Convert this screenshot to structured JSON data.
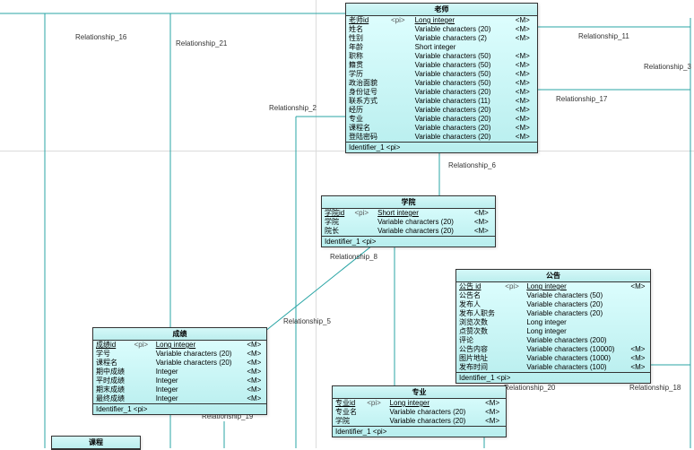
{
  "chart_data": {
    "type": "table",
    "description": "ER conceptual data model (PowerDesigner style)",
    "entities": [
      {
        "name": "老师",
        "identifier": "Identifier_1 <pi>",
        "attributes": [
          [
            "老师id",
            "<pi>",
            "Long integer",
            "<M>"
          ],
          [
            "姓名",
            "",
            "Variable characters (20)",
            "<M>"
          ],
          [
            "性别",
            "",
            "Variable characters (2)",
            "<M>"
          ],
          [
            "年龄",
            "",
            "Short integer",
            ""
          ],
          [
            "职称",
            "",
            "Variable characters (50)",
            "<M>"
          ],
          [
            "籍贯",
            "",
            "Variable characters (50)",
            "<M>"
          ],
          [
            "学历",
            "",
            "Variable characters (50)",
            "<M>"
          ],
          [
            "政治面貌",
            "",
            "Variable characters (50)",
            "<M>"
          ],
          [
            "身份证号",
            "",
            "Variable characters (20)",
            "<M>"
          ],
          [
            "联系方式",
            "",
            "Variable characters (11)",
            "<M>"
          ],
          [
            "经历",
            "",
            "Variable characters (20)",
            "<M>"
          ],
          [
            "专业",
            "",
            "Variable characters (20)",
            "<M>"
          ],
          [
            "课程名",
            "",
            "Variable characters (20)",
            "<M>"
          ],
          [
            "登陆密码",
            "",
            "Variable characters (20)",
            "<M>"
          ]
        ]
      },
      {
        "name": "学院",
        "identifier": "Identifier_1 <pi>",
        "attributes": [
          [
            "学院id",
            "<pi>",
            "Short integer",
            "<M>"
          ],
          [
            "学院",
            "",
            "Variable characters (20)",
            "<M>"
          ],
          [
            "院长",
            "",
            "Variable characters (20)",
            "<M>"
          ]
        ]
      },
      {
        "name": "公告",
        "identifier": "Identifier_1 <pi>",
        "attributes": [
          [
            "公告 id",
            "<pi>",
            "Long integer",
            "<M>"
          ],
          [
            "公告名",
            "",
            "Variable characters (50)",
            ""
          ],
          [
            "发布人",
            "",
            "Variable characters (20)",
            ""
          ],
          [
            "发布人职务",
            "",
            "Variable characters (20)",
            ""
          ],
          [
            "浏览次数",
            "",
            "Long integer",
            ""
          ],
          [
            "点赞次数",
            "",
            "Long integer",
            ""
          ],
          [
            "评论",
            "",
            "Variable characters (200)",
            ""
          ],
          [
            "公告内容",
            "",
            "Variable characters (10000)",
            "<M>"
          ],
          [
            "图片地址",
            "",
            "Variable characters (1000)",
            "<M>"
          ],
          [
            "发布时间",
            "",
            "Variable characters (100)",
            "<M>"
          ]
        ]
      },
      {
        "name": "成绩",
        "identifier": "Identifier_1 <pi>",
        "attributes": [
          [
            "成绩id",
            "<pi>",
            "Long integer",
            "<M>"
          ],
          [
            "学号",
            "",
            "Variable characters (20)",
            "<M>"
          ],
          [
            "课程名",
            "",
            "Variable characters (20)",
            "<M>"
          ],
          [
            "期中成绩",
            "",
            "Integer",
            "<M>"
          ],
          [
            "平时成绩",
            "",
            "Integer",
            "<M>"
          ],
          [
            "期末成绩",
            "",
            "Integer",
            "<M>"
          ],
          [
            "最终成绩",
            "",
            "Integer",
            "<M>"
          ]
        ]
      },
      {
        "name": "专业",
        "identifier": "Identifier_1 <pi>",
        "attributes": [
          [
            "专业id",
            "<pi>",
            "Long integer",
            "<M>"
          ],
          [
            "专业名",
            "",
            "Variable characters (20)",
            "<M>"
          ],
          [
            "学院",
            "",
            "Variable characters (20)",
            "<M>"
          ]
        ]
      },
      {
        "name": "课程",
        "identifier": "",
        "attributes": []
      }
    ],
    "relationships": [
      "Relationship_2",
      "Relationship_3",
      "Relationship_5",
      "Relationship_6",
      "Relationship_8",
      "Relationship_11",
      "Relationship_16",
      "Relationship_17",
      "Relationship_18",
      "Relationship_19",
      "Relationship_20",
      "Relationship_21"
    ]
  },
  "labels": {
    "grid": {
      "h": 168,
      "v": 352
    },
    "rel": {
      "r2": "Relationship_2",
      "r3": "Relationship_3",
      "r5": "Relationship_5",
      "r6": "Relationship_6",
      "r8": "Relationship_8",
      "r11": "Relationship_11",
      "r16": "Relationship_16",
      "r17": "Relationship_17",
      "r18": "Relationship_18",
      "r19": "Relationship_19",
      "r20": "Relationship_20",
      "r21": "Relationship_21"
    },
    "entities": {
      "teacher": {
        "title": "老师",
        "ident": "Identifier_1 <pi>",
        "rows": [
          {
            "c1": "老师id",
            "c2": "<pi>",
            "c3": "Long integer",
            "c4": "<M>"
          },
          {
            "c1": "姓名",
            "c2": "",
            "c3": "Variable characters (20)",
            "c4": "<M>"
          },
          {
            "c1": "性别",
            "c2": "",
            "c3": "Variable characters (2)",
            "c4": "<M>"
          },
          {
            "c1": "年龄",
            "c2": "",
            "c3": "Short integer",
            "c4": ""
          },
          {
            "c1": "职称",
            "c2": "",
            "c3": "Variable characters (50)",
            "c4": "<M>"
          },
          {
            "c1": "籍贯",
            "c2": "",
            "c3": "Variable characters (50)",
            "c4": "<M>"
          },
          {
            "c1": "学历",
            "c2": "",
            "c3": "Variable characters (50)",
            "c4": "<M>"
          },
          {
            "c1": "政治面貌",
            "c2": "",
            "c3": "Variable characters (50)",
            "c4": "<M>"
          },
          {
            "c1": "身份证号",
            "c2": "",
            "c3": "Variable characters (20)",
            "c4": "<M>"
          },
          {
            "c1": "联系方式",
            "c2": "",
            "c3": "Variable characters (11)",
            "c4": "<M>"
          },
          {
            "c1": "经历",
            "c2": "",
            "c3": "Variable characters (20)",
            "c4": "<M>"
          },
          {
            "c1": "专业",
            "c2": "",
            "c3": "Variable characters (20)",
            "c4": "<M>"
          },
          {
            "c1": "课程名",
            "c2": "",
            "c3": "Variable characters (20)",
            "c4": "<M>"
          },
          {
            "c1": "登陆密码",
            "c2": "",
            "c3": "Variable characters (20)",
            "c4": "<M>"
          }
        ]
      },
      "college": {
        "title": "学院",
        "ident": "Identifier_1 <pi>",
        "rows": [
          {
            "c1": "学院id",
            "c2": "<pi>",
            "c3": "Short integer",
            "c4": "<M>"
          },
          {
            "c1": "学院",
            "c2": "",
            "c3": "Variable characters (20)",
            "c4": "<M>"
          },
          {
            "c1": "院长",
            "c2": "",
            "c3": "Variable characters (20)",
            "c4": "<M>"
          }
        ]
      },
      "announce": {
        "title": "公告",
        "ident": "Identifier_1 <pi>",
        "rows": [
          {
            "c1": "公告 id",
            "c2": "<pi>",
            "c3": "Long integer",
            "c4": "<M>"
          },
          {
            "c1": "公告名",
            "c2": "",
            "c3": "Variable characters (50)",
            "c4": ""
          },
          {
            "c1": "发布人",
            "c2": "",
            "c3": "Variable characters (20)",
            "c4": ""
          },
          {
            "c1": "发布人职务",
            "c2": "",
            "c3": "Variable characters (20)",
            "c4": ""
          },
          {
            "c1": "浏览次数",
            "c2": "",
            "c3": "Long integer",
            "c4": ""
          },
          {
            "c1": "点赞次数",
            "c2": "",
            "c3": "Long integer",
            "c4": ""
          },
          {
            "c1": "评论",
            "c2": "",
            "c3": "Variable characters (200)",
            "c4": ""
          },
          {
            "c1": "公告内容",
            "c2": "",
            "c3": "Variable characters (10000)",
            "c4": "<M>"
          },
          {
            "c1": "图片地址",
            "c2": "",
            "c3": "Variable characters (1000)",
            "c4": "<M>"
          },
          {
            "c1": "发布时间",
            "c2": "",
            "c3": "Variable characters (100)",
            "c4": "<M>"
          }
        ]
      },
      "grade": {
        "title": "成绩",
        "ident": "Identifier_1 <pi>",
        "rows": [
          {
            "c1": "成绩id",
            "c2": "<pi>",
            "c3": "Long integer",
            "c4": "<M>"
          },
          {
            "c1": "学号",
            "c2": "",
            "c3": "Variable characters (20)",
            "c4": "<M>"
          },
          {
            "c1": "课程名",
            "c2": "",
            "c3": "Variable characters (20)",
            "c4": "<M>"
          },
          {
            "c1": "期中成绩",
            "c2": "",
            "c3": "Integer",
            "c4": "<M>"
          },
          {
            "c1": "平时成绩",
            "c2": "",
            "c3": "Integer",
            "c4": "<M>"
          },
          {
            "c1": "期末成绩",
            "c2": "",
            "c3": "Integer",
            "c4": "<M>"
          },
          {
            "c1": "最终成绩",
            "c2": "",
            "c3": "Integer",
            "c4": "<M>"
          }
        ]
      },
      "major": {
        "title": "专业",
        "ident": "Identifier_1 <pi>",
        "rows": [
          {
            "c1": "专业id",
            "c2": "<pi>",
            "c3": "Long integer",
            "c4": "<M>"
          },
          {
            "c1": "专业名",
            "c2": "",
            "c3": "Variable characters (20)",
            "c4": "<M>"
          },
          {
            "c1": "学院",
            "c2": "",
            "c3": "Variable characters (20)",
            "c4": "<M>"
          }
        ]
      },
      "course": {
        "title": "课程"
      }
    }
  }
}
